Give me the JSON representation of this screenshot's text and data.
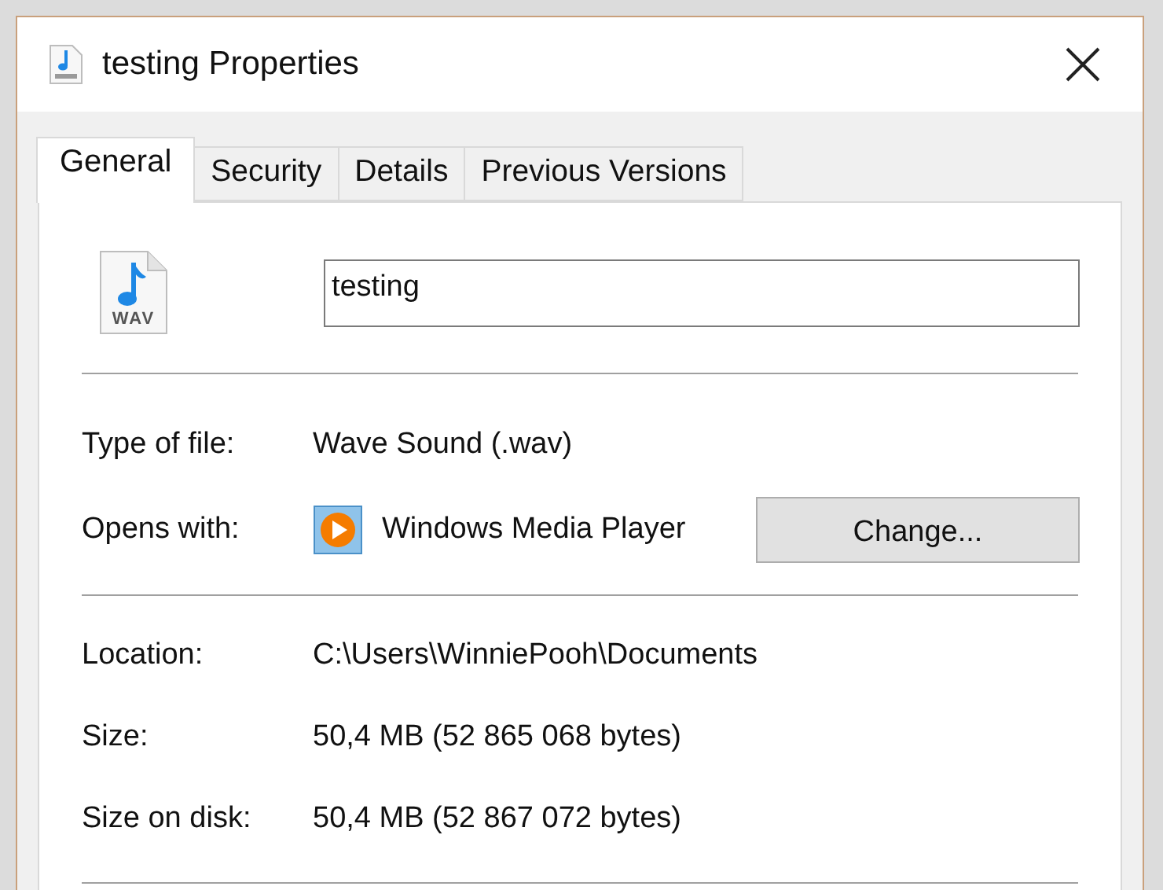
{
  "window": {
    "title": "testing Properties"
  },
  "tabs": [
    {
      "label": "General",
      "selected": true
    },
    {
      "label": "Security",
      "selected": false
    },
    {
      "label": "Details",
      "selected": false
    },
    {
      "label": "Previous Versions",
      "selected": false
    }
  ],
  "file": {
    "icon_label": "WAV",
    "name": "testing"
  },
  "sections": [
    [
      {
        "kind": "text",
        "label": "Type of file:",
        "value": "Wave Sound (.wav)"
      },
      {
        "kind": "app",
        "label": "Opens with:",
        "value": "Windows Media Player",
        "button": "Change..."
      }
    ],
    [
      {
        "kind": "text",
        "label": "Location:",
        "value": "C:\\Users\\WinniePooh\\Documents"
      },
      {
        "kind": "text",
        "label": "Size:",
        "value": "50,4 MB (52 865 068 bytes)"
      },
      {
        "kind": "text",
        "label": "Size on disk:",
        "value": "50,4 MB (52 867 072 bytes)"
      }
    ]
  ]
}
